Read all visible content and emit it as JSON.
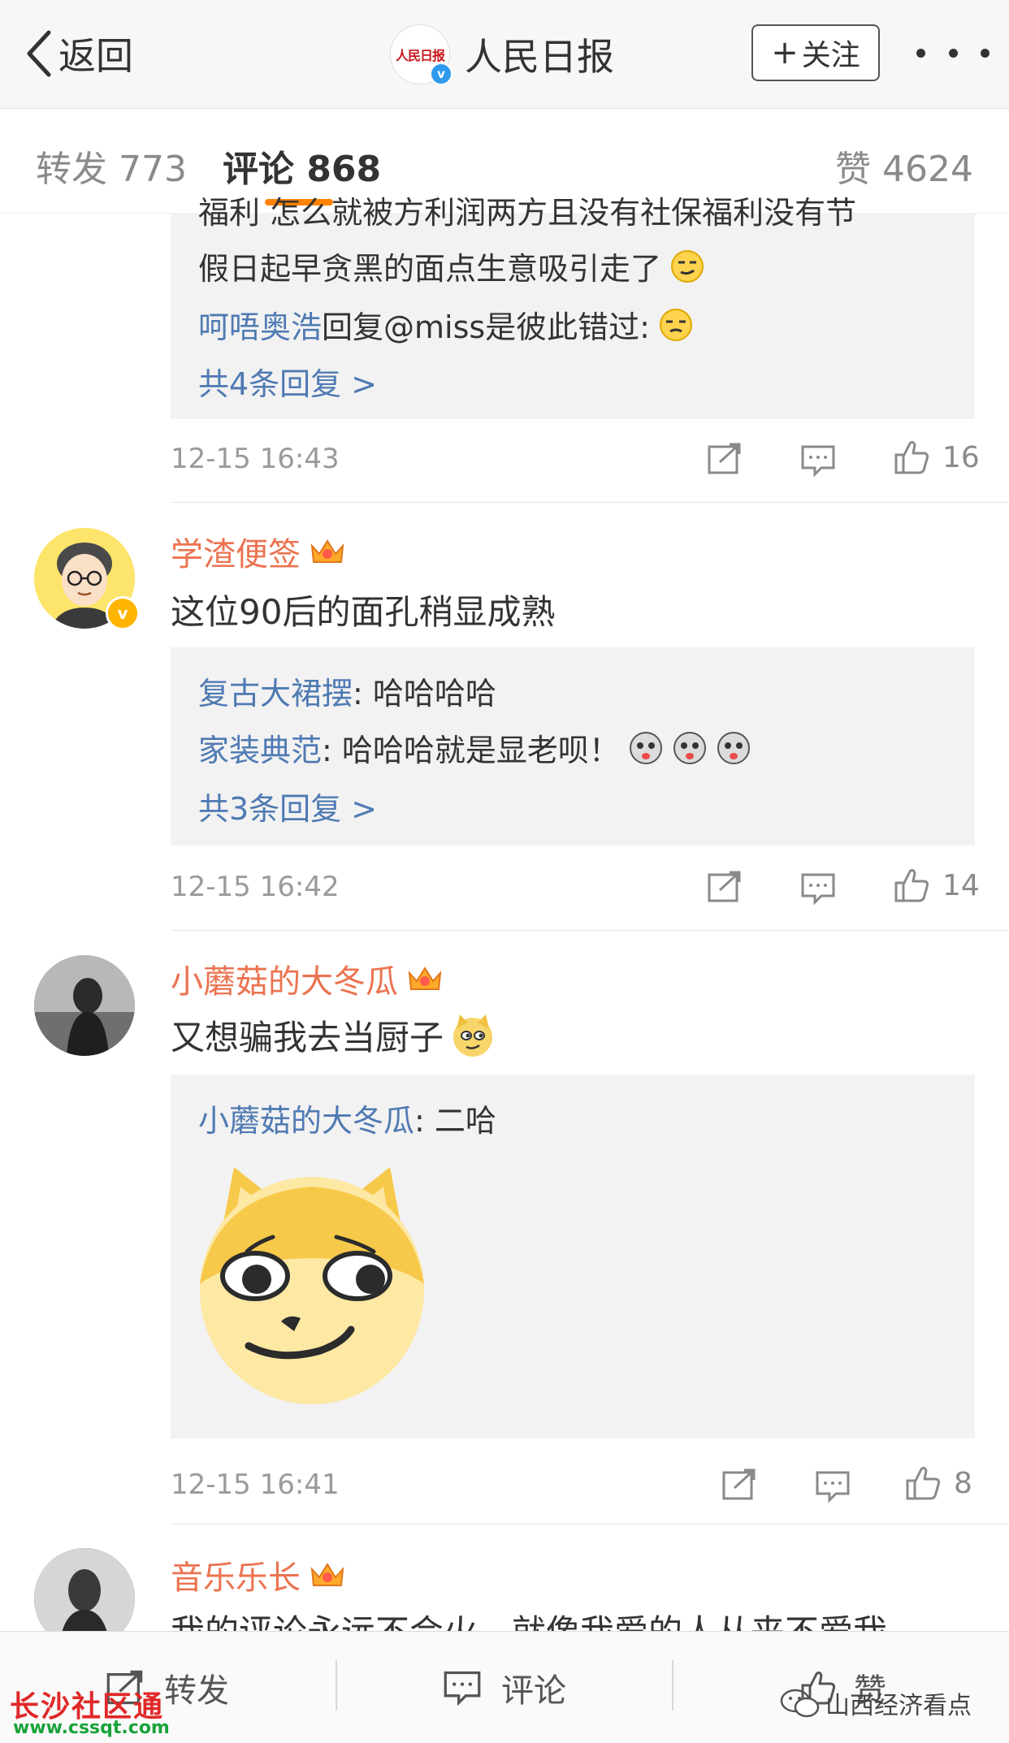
{
  "nav": {
    "back_label": "返回",
    "title": "人民日报",
    "logo_text": "人民日报",
    "verified_mark": "v",
    "follow_label": "关注",
    "follow_plus": "+"
  },
  "tabs": {
    "repost": "转发 773",
    "comments": "评论 868",
    "likes": "赞 4624"
  },
  "comments": [
    {
      "partial_text_1": "福利 怎么就被方利润两方且没有社保福利没有节",
      "partial_text_2": "假日起早贪黑的面点生意吸引走了",
      "reply_user": "呵唔奥浩",
      "reply_text": "回复@miss是彼此错过:",
      "reply_more": "共4条回复 >",
      "time": "12-15 16:43",
      "likes": "16"
    },
    {
      "user": "学渣便签",
      "avatar_badge": "v",
      "text": "这位90后的面孔稍显成熟",
      "replies": [
        {
          "user": "复古大裙摆",
          "text": ": 哈哈哈哈"
        },
        {
          "user": "家装典范",
          "text": ": 哈哈哈就是显老呗！"
        }
      ],
      "reply_more": "共3条回复 >",
      "time": "12-15 16:42",
      "likes": "14"
    },
    {
      "user": "小蘑菇的大冬瓜",
      "text": "又想骗我去当厨子",
      "replies": [
        {
          "user": "小蘑菇的大冬瓜",
          "text": ": 二哈"
        }
      ],
      "time": "12-15 16:41",
      "likes": "8"
    },
    {
      "user": "音乐乐长",
      "text": "我的评论永远不会火，就像我爱的人从来不爱我"
    }
  ],
  "bottom": {
    "repost": "转发",
    "comment": "评论",
    "like": "赞"
  },
  "watermarks": {
    "left_main": "长沙社区通",
    "left_url": "www.cssqt.com",
    "right": "山西经济看点"
  },
  "colors": {
    "accent": "#ff8200",
    "username": "#eb7350",
    "reply_user": "#4f7ab3",
    "verified": "#2d9aed"
  }
}
